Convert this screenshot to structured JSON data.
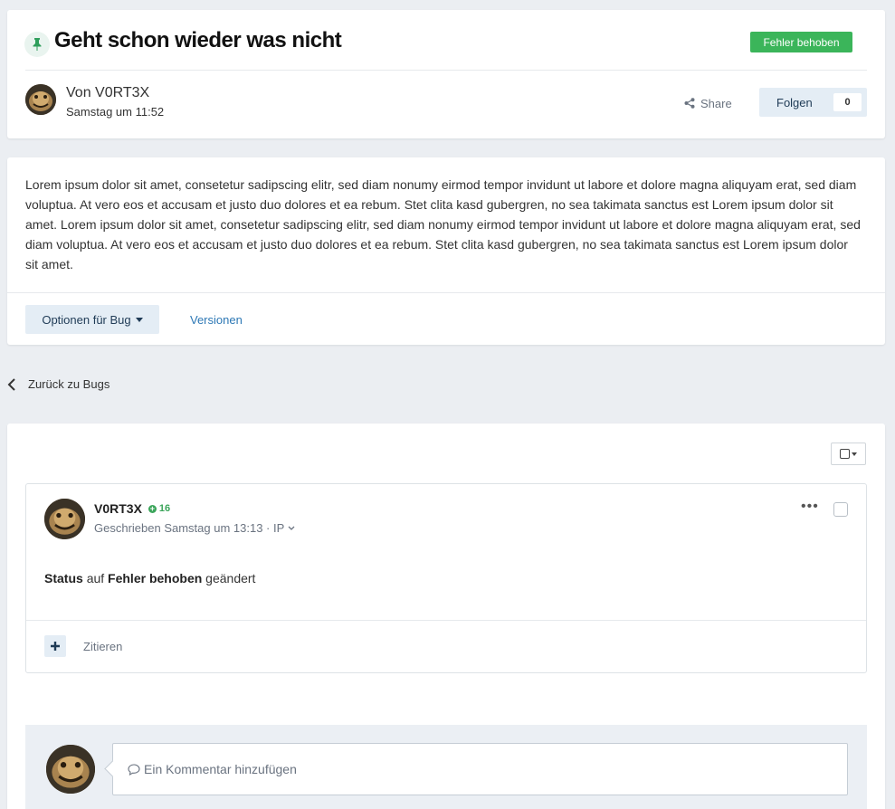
{
  "header": {
    "title": "Geht schon wieder was nicht",
    "status": "Fehler behoben",
    "author_line": "Von V0RT3X",
    "date": "Samstag um 11:52",
    "share_label": "Share",
    "follow_label": "Folgen",
    "follow_count": "0",
    "icons": {
      "pin": "pin-icon",
      "share": "share-icon"
    },
    "colors": {
      "status": "#3bb55a",
      "pin": "#2e9e5b"
    }
  },
  "description": {
    "text": "Lorem ipsum dolor sit amet, consetetur sadipscing elitr, sed diam nonumy eirmod tempor invidunt ut labore et dolore magna aliquyam erat, sed diam voluptua. At vero eos et accusam et justo duo dolores et ea rebum. Stet clita kasd gubergren, no sea takimata sanctus est Lorem ipsum dolor sit amet. Lorem ipsum dolor sit amet, consetetur sadipscing elitr, sed diam nonumy eirmod tempor invidunt ut labore et dolore magna aliquyam erat, sed diam voluptua. At vero eos et accusam et justo duo dolores et ea rebum. Stet clita kasd gubergren, no sea takimata sanctus est Lorem ipsum dolor sit amet.",
    "options_label": "Optionen für Bug",
    "versions_label": "Versionen"
  },
  "nav": {
    "back_label": "Zurück zu Bugs"
  },
  "comment": {
    "author": "V0RT3X",
    "reputation": "16",
    "meta": "Geschrieben Samstag um 13:13 · IP",
    "body_status": "Status",
    "body_on": "auf",
    "body_value": "Fehler behoben",
    "body_changed": "geändert",
    "menu": "•••",
    "quote_label": "Zitieren"
  },
  "reply": {
    "placeholder": "Ein Kommentar hinzufügen"
  }
}
